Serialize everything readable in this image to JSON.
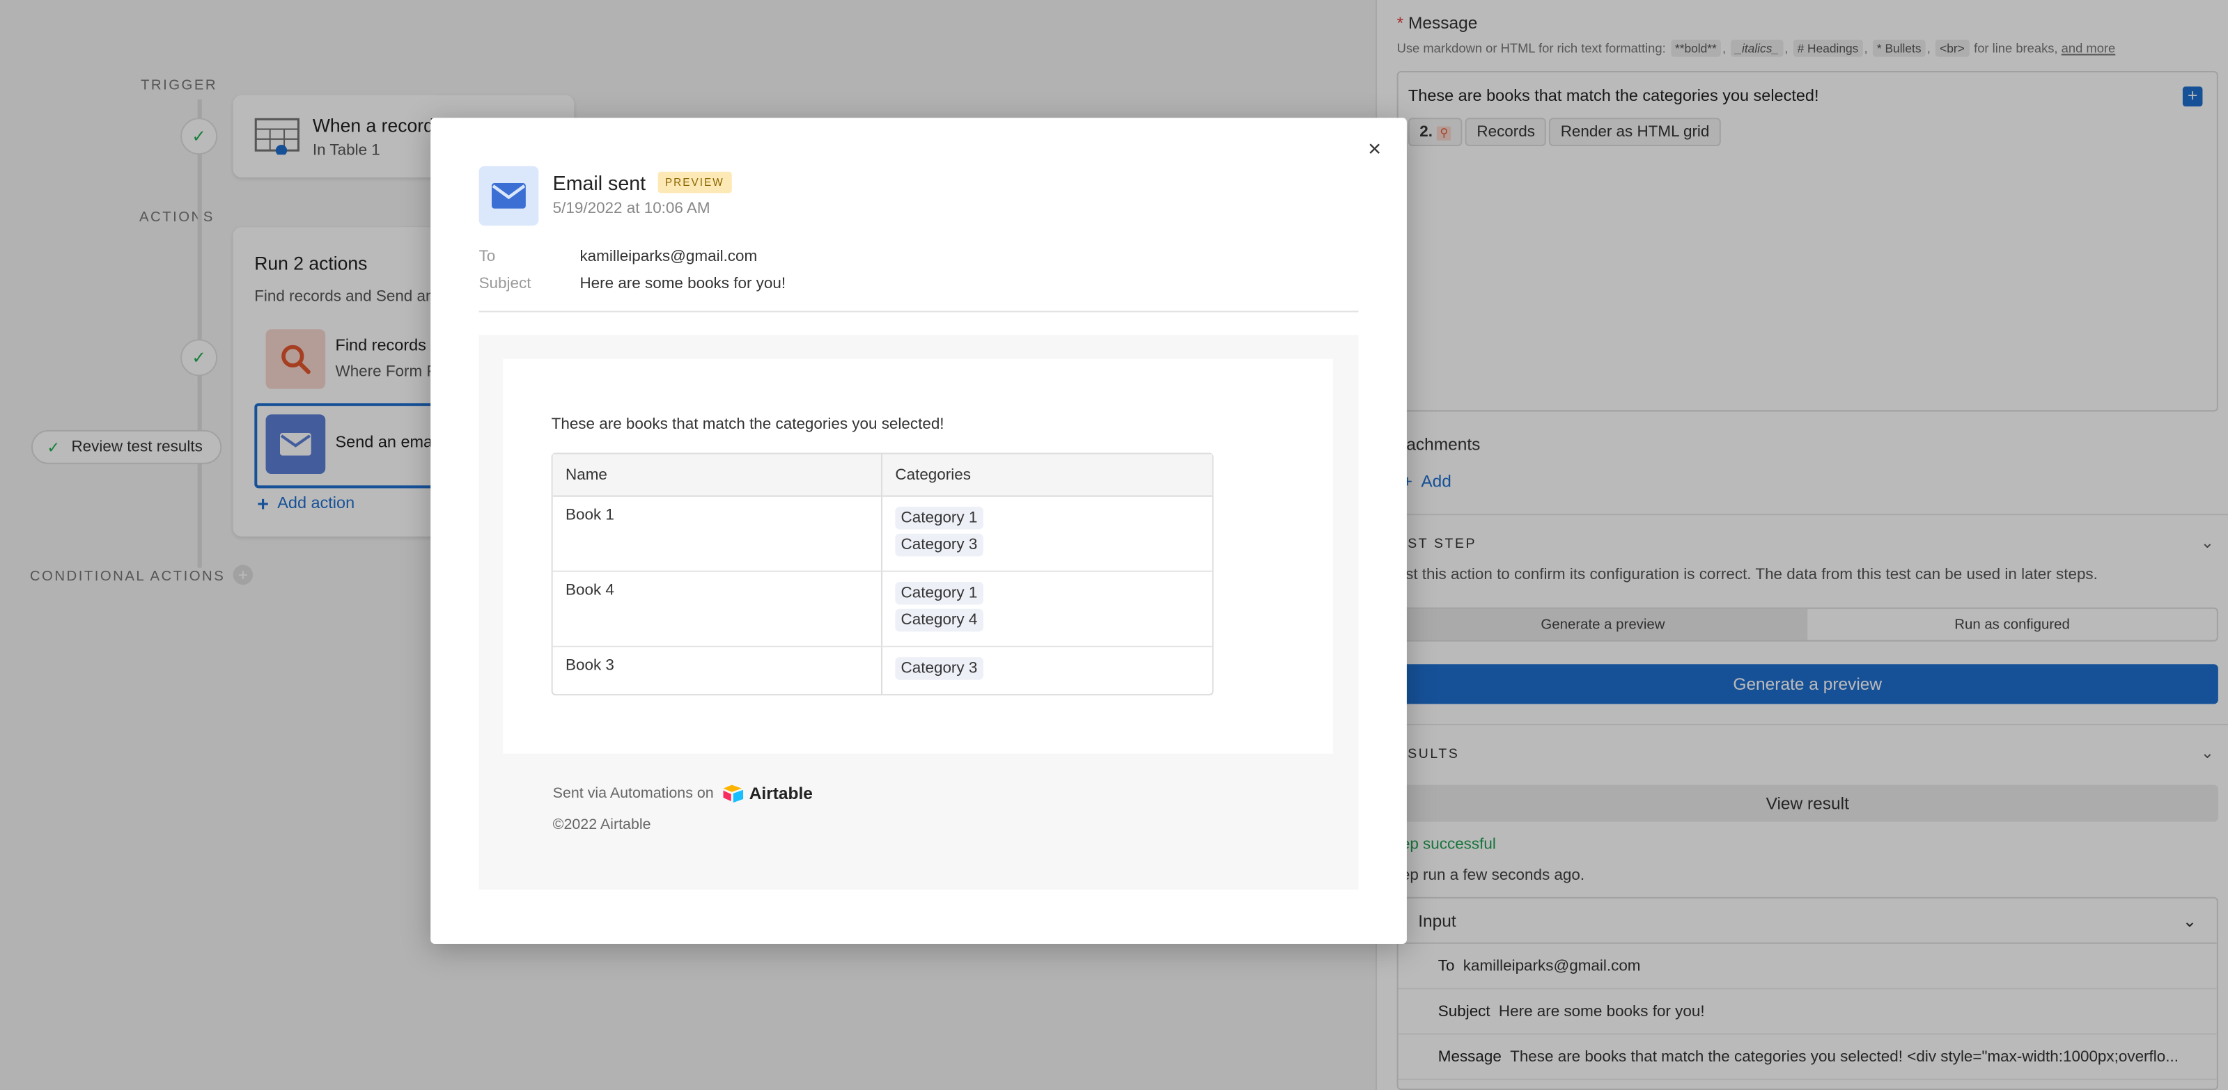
{
  "canvas": {
    "trigger_label": "TRIGGER",
    "actions_label": "ACTIONS",
    "conditional_label": "CONDITIONAL ACTIONS",
    "trigger_title": "When a record",
    "trigger_sub": "In Table 1",
    "run_title": "Run 2 actions",
    "run_sub": "Find records and Send an",
    "find_title": "Find records",
    "find_sub": "Where Form F",
    "send_title": "Send an emai",
    "add_action": "Add action",
    "review_label": "Review test results"
  },
  "panel": {
    "message_label": "Message",
    "hint_prefix": "Use markdown or HTML for rich text formatting:",
    "hint_chips": [
      "**bold**",
      "_italics_",
      "# Headings",
      "* Bullets",
      "<br>"
    ],
    "hint_suffix": "for line breaks,",
    "hint_link": "and more",
    "message_text": "These are books that match the categories you selected!",
    "token_num": "2.",
    "token_records": "Records",
    "token_render": "Render as HTML grid",
    "attachments_label": "ttachments",
    "add_label": "Add",
    "test_step_label": "EST STEP",
    "test_step_desc": "est this action to confirm its configuration is correct. The data from this test can be used in later steps.",
    "seg_preview": "Generate a preview",
    "seg_run": "Run as configured",
    "generate_btn": "Generate a preview",
    "results_label": "ESULTS",
    "view_result": "View result",
    "step_success": "tep successful",
    "step_run": "tep run a few seconds ago.",
    "input_label": "Input",
    "to_label": "To",
    "to_value": "kamilleiparks@gmail.com",
    "subject_label": "Subject",
    "subject_value": "Here are some books for you!",
    "message_row_label": "Message",
    "message_row_value": "These are books that match the categories you selected! <div style=\"max-width:1000px;overflo..."
  },
  "modal": {
    "title": "Email sent",
    "badge": "PREVIEW",
    "date": "5/19/2022 at 10:06 AM",
    "to_label": "To",
    "to_value": "kamilleiparks@gmail.com",
    "subject_label": "Subject",
    "subject_value": "Here are some books for you!",
    "intro": "These are books that match the categories you selected!",
    "columns": [
      "Name",
      "Categories"
    ],
    "rows": [
      {
        "name": "Book 1",
        "categories": [
          "Category 1",
          "Category 3"
        ]
      },
      {
        "name": "Book 4",
        "categories": [
          "Category 1",
          "Category 4"
        ]
      },
      {
        "name": "Book 3",
        "categories": [
          "Category 3"
        ]
      }
    ],
    "sent_via": "Sent via Automations on",
    "brand": "Airtable",
    "copyright": "©2022 Airtable",
    "close": "×"
  },
  "colors": {
    "accent": "#1f6fd1",
    "success": "#20b050",
    "badge_bg": "#fde9b5"
  }
}
